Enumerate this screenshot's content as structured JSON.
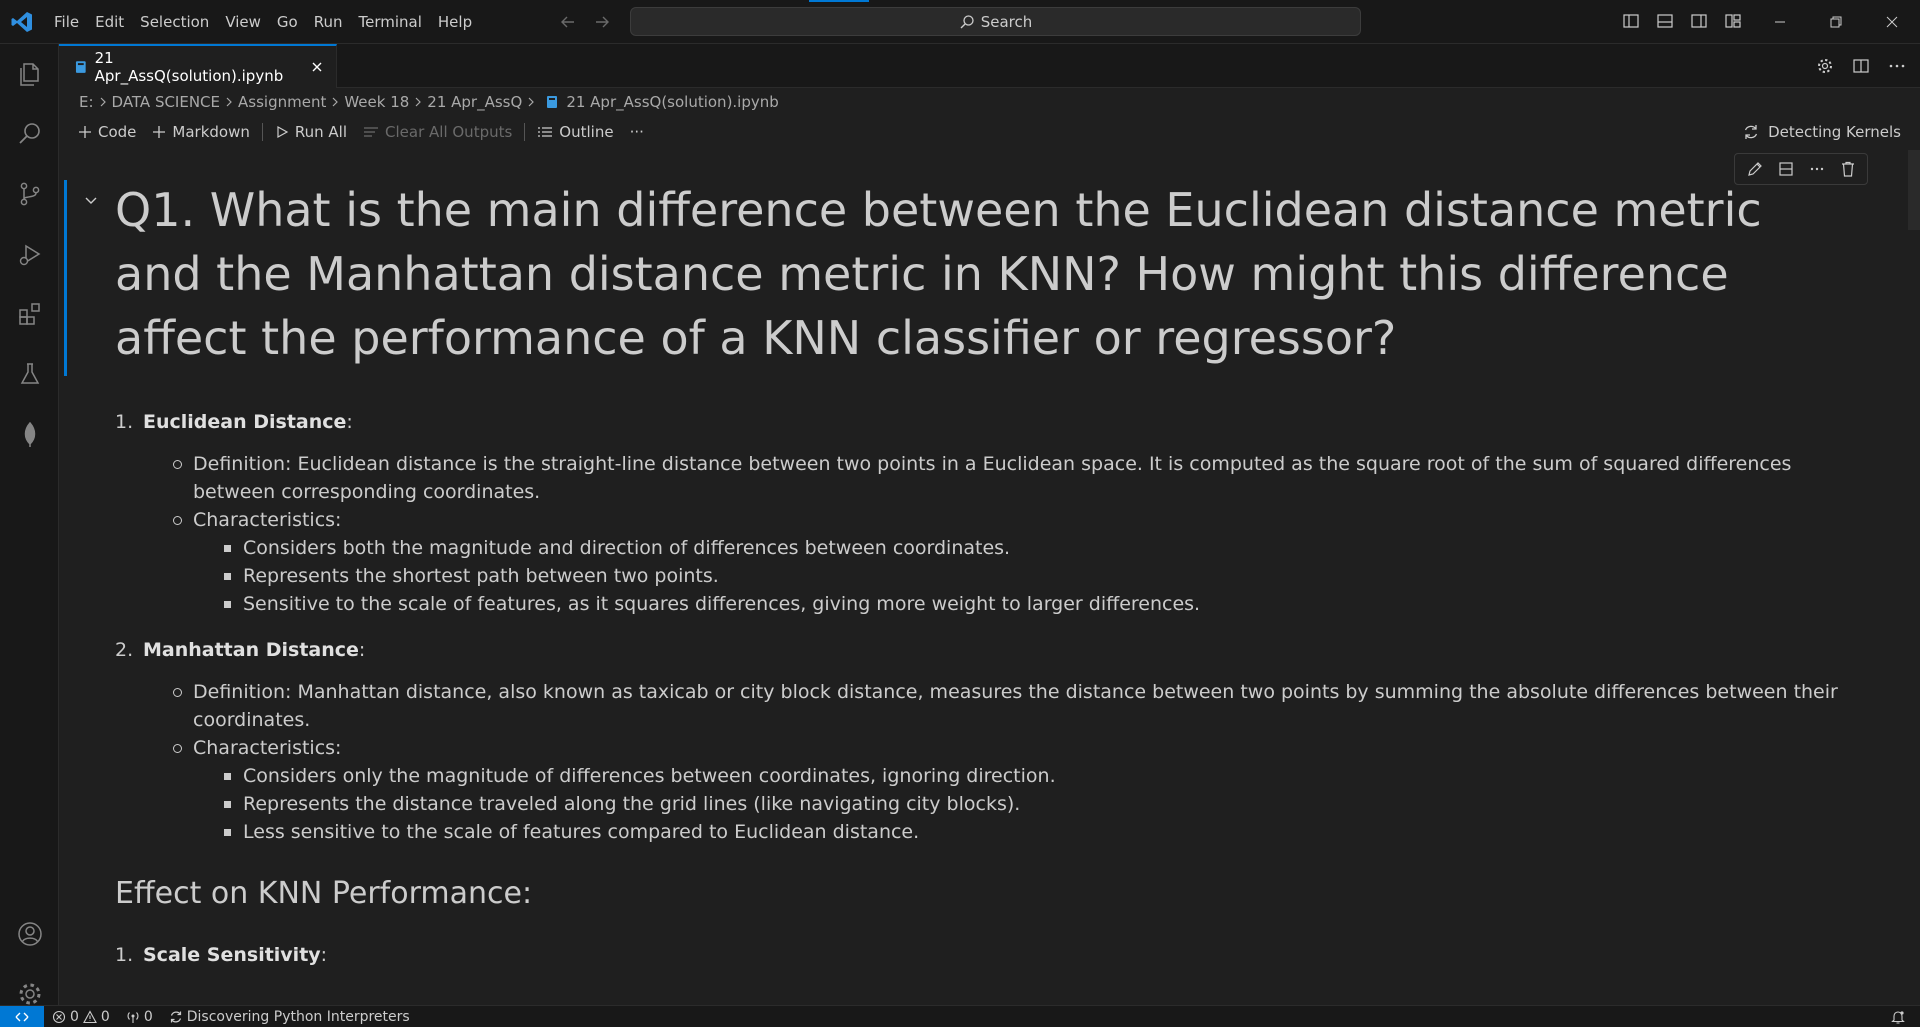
{
  "menu": [
    "File",
    "Edit",
    "Selection",
    "View",
    "Go",
    "Run",
    "Terminal",
    "Help"
  ],
  "search": {
    "label": "Search"
  },
  "tab": {
    "label": "21 Apr_AssQ(solution).ipynb"
  },
  "breadcrumb": [
    "E:",
    "DATA SCIENCE",
    "Assignment",
    "Week 18",
    "21 Apr_AssQ",
    "21 Apr_AssQ(solution).ipynb"
  ],
  "toolbar": {
    "code": "Code",
    "markdown": "Markdown",
    "run_all": "Run All",
    "clear_outputs": "Clear All Outputs",
    "outline": "Outline",
    "more": "···",
    "kernel": "Detecting Kernels"
  },
  "cell": {
    "heading": "Q1. What is the main difference between the Euclidean distance metric and the Manhattan distance metric in KNN? How might this difference affect the performance of a KNN classifier or regressor?",
    "items": [
      {
        "num": "1.",
        "title": "Euclidean Distance",
        "suffix": ":",
        "definition": "Definition: Euclidean distance is the straight-line distance between two points in a Euclidean space. It is computed as the square root of the sum of squared differences between corresponding coordinates.",
        "characteristics_label": "Characteristics:",
        "characteristics": [
          "Considers both the magnitude and direction of differences between coordinates.",
          "Represents the shortest path between two points.",
          "Sensitive to the scale of features, as it squares differences, giving more weight to larger differences."
        ]
      },
      {
        "num": "2.",
        "title": "Manhattan Distance",
        "suffix": ":",
        "definition": "Definition: Manhattan distance, also known as taxicab or city block distance, measures the distance between two points by summing the absolute differences between their coordinates.",
        "characteristics_label": "Characteristics:",
        "characteristics": [
          "Considers only the magnitude of differences between coordinates, ignoring direction.",
          "Represents the distance traveled along the grid lines (like navigating city blocks).",
          "Less sensitive to the scale of features compared to Euclidean distance."
        ]
      }
    ],
    "subheading": "Effect on KNN Performance:",
    "next_item": {
      "num": "1.",
      "title": "Scale Sensitivity",
      "suffix": ":"
    }
  },
  "status": {
    "errors": "0",
    "warnings": "0",
    "ports": "0",
    "task": "Discovering Python Interpreters"
  },
  "colors": {
    "accent": "#0078d4",
    "background": "#1f1f1f",
    "chrome": "#181818"
  }
}
